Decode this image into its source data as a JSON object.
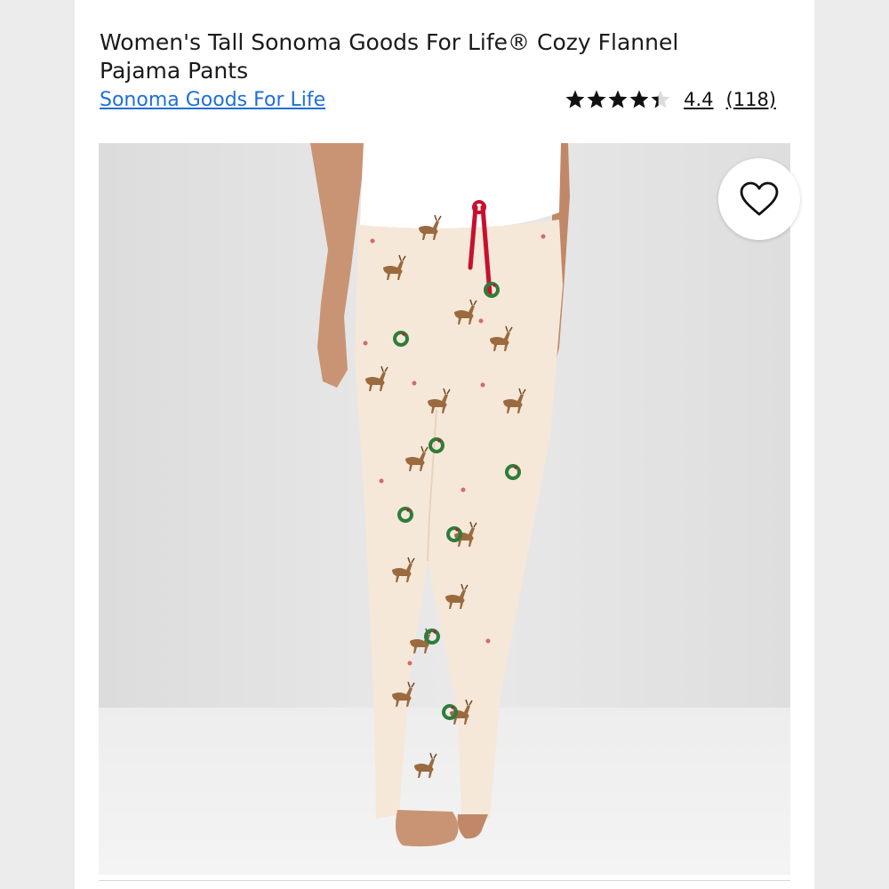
{
  "product": {
    "title": "Women's Tall Sonoma Goods For Life® Cozy Flannel Pajama Pants",
    "brand": "Sonoma Goods For Life",
    "rating_value": "4.4",
    "review_count": "(118)",
    "rating_fraction": 0.88
  },
  "icons": {
    "favorite": "heart-icon",
    "rating": "star-icon"
  },
  "colors": {
    "brand_link": "#1f6fd6",
    "text": "#1a1a1a",
    "drawstring": "#c8102e",
    "pants": "#f5e7d6"
  }
}
